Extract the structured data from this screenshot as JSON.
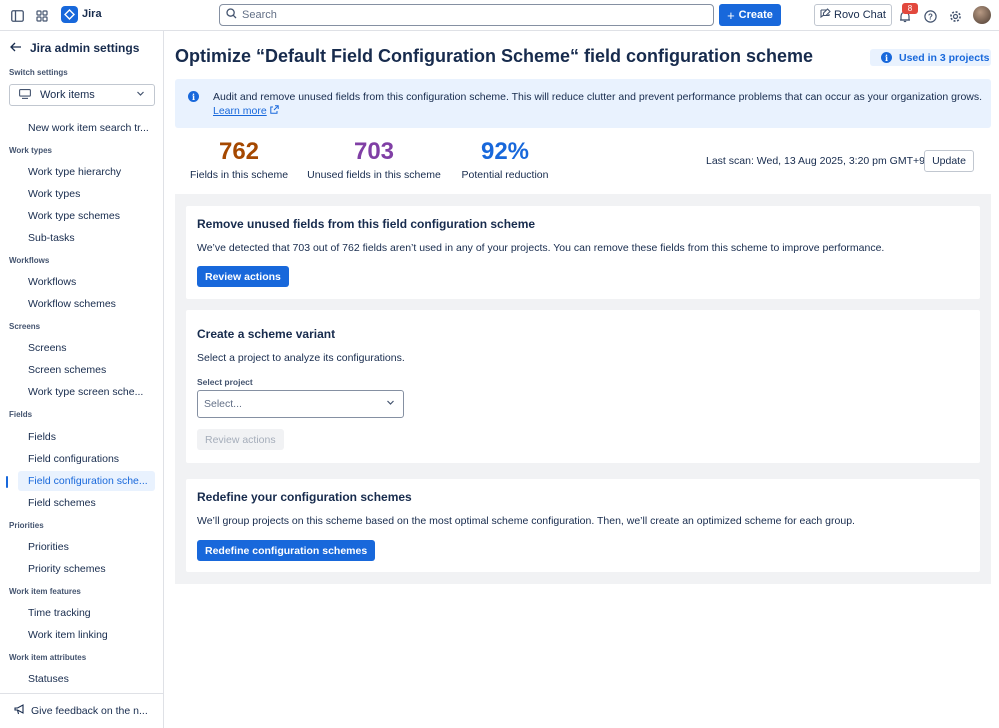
{
  "topbar": {
    "app_name": "Jira",
    "search_placeholder": "Search",
    "create_label": "Create",
    "rovo_label": "Rovo Chat",
    "notification_count": "8"
  },
  "sidebar": {
    "back_title": "Jira admin settings",
    "switch_label": "Switch settings",
    "switch_value": "Work items",
    "sections": [
      {
        "title": "",
        "items": [
          {
            "label": "New work item search tr..."
          }
        ]
      },
      {
        "title": "Work types",
        "items": [
          {
            "label": "Work type hierarchy"
          },
          {
            "label": "Work types"
          },
          {
            "label": "Work type schemes"
          },
          {
            "label": "Sub-tasks"
          }
        ]
      },
      {
        "title": "Workflows",
        "items": [
          {
            "label": "Workflows"
          },
          {
            "label": "Workflow schemes"
          }
        ]
      },
      {
        "title": "Screens",
        "items": [
          {
            "label": "Screens"
          },
          {
            "label": "Screen schemes"
          },
          {
            "label": "Work type screen sche..."
          }
        ]
      },
      {
        "title": "Fields",
        "items": [
          {
            "label": "Fields"
          },
          {
            "label": "Field configurations"
          },
          {
            "label": "Field configuration sche...",
            "active": true
          },
          {
            "label": "Field schemes"
          }
        ]
      },
      {
        "title": "Priorities",
        "items": [
          {
            "label": "Priorities"
          },
          {
            "label": "Priority schemes"
          }
        ]
      },
      {
        "title": "Work item features",
        "items": [
          {
            "label": "Time tracking"
          },
          {
            "label": "Work item linking"
          }
        ]
      },
      {
        "title": "Work item attributes",
        "items": [
          {
            "label": "Statuses"
          }
        ]
      }
    ],
    "feedback_label": "Give feedback on the n..."
  },
  "main": {
    "title": "Optimize “Default Field Configuration Scheme“ field configuration scheme",
    "used_in": "Used in 3 projects",
    "banner_text": "Audit and remove unused fields from this configuration scheme. This will reduce clutter and prevent performance problems that can occur as your organization grows.",
    "banner_link": "Learn more",
    "stats": [
      {
        "value": "762",
        "label": "Fields in this scheme",
        "color": "#a54800"
      },
      {
        "value": "703",
        "label": "Unused fields in this scheme",
        "color": "#803fa5"
      },
      {
        "value": "92%",
        "label": "Potential reduction",
        "color": "#1868db"
      }
    ],
    "last_scan": "Last scan: Wed, 13 Aug 2025, 3:20 pm GMT+9",
    "update_label": "Update",
    "cards": {
      "remove": {
        "title": "Remove unused fields from this field configuration scheme",
        "text": "We’ve detected that 703 out of 762 fields aren’t used in any of your projects. You can remove these fields from this scheme to improve performance.",
        "button": "Review actions"
      },
      "variant": {
        "title": "Create a scheme variant",
        "text": "Select a project to analyze its configurations.",
        "field_label": "Select project",
        "placeholder": "Select...",
        "button": "Review actions"
      },
      "redefine": {
        "title": "Redefine your configuration schemes",
        "text": "We’ll group projects on this scheme based on the most optimal scheme configuration. Then, we’ll create an optimized scheme for each group.",
        "button": "Redefine configuration schemes"
      }
    }
  }
}
